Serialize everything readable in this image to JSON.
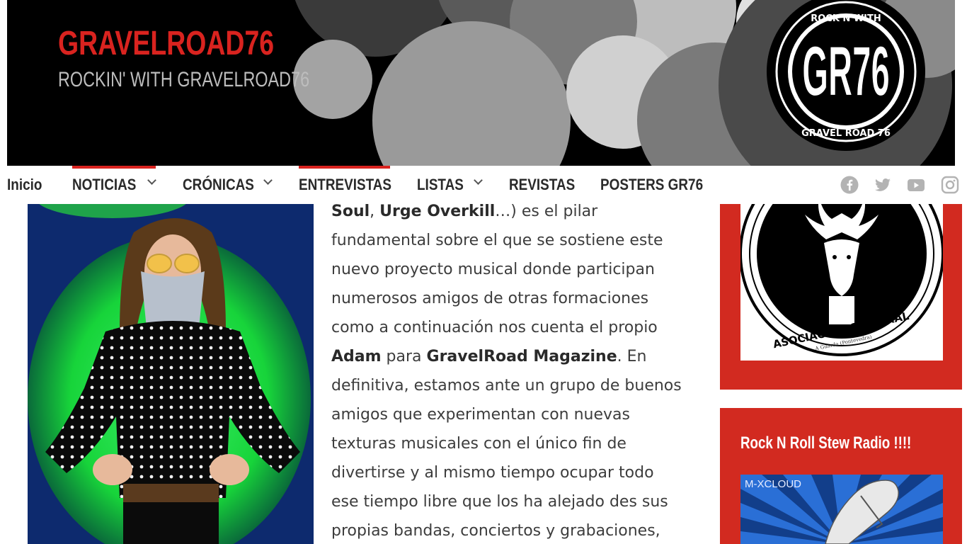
{
  "header": {
    "site_title": "GRAVELROAD76",
    "tagline": "ROCKIN' WITH GRAVELROAD76",
    "logo": {
      "top_text": "ROCK N WITH",
      "center_text": "GR76",
      "bottom_text": "GRAVEL ROAD 76"
    },
    "colors": {
      "title": "#d9231f",
      "banner_bg": "#000000"
    }
  },
  "nav": {
    "items": [
      {
        "label": "Inicio",
        "dropdown": false,
        "active": false
      },
      {
        "label": "NOTICIAS",
        "dropdown": true,
        "active": true
      },
      {
        "label": "CRÓNICAS",
        "dropdown": true,
        "active": false
      },
      {
        "label": "ENTREVISTAS",
        "dropdown": false,
        "active": true
      },
      {
        "label": "LISTAS",
        "dropdown": true,
        "active": false
      },
      {
        "label": "REVISTAS",
        "dropdown": false,
        "active": false
      },
      {
        "label": "POSTERS GR76",
        "dropdown": false,
        "active": false
      }
    ],
    "social": [
      "facebook-icon",
      "twitter-icon",
      "youtube-icon",
      "instagram-icon"
    ],
    "accent": "#d9231f"
  },
  "article": {
    "t1": "Soul",
    "t2": ", ",
    "t3": "Urge Overkill",
    "t4": "…) es el pilar fundamental sobre el que se sostiene este nuevo proyecto musical donde participan numerosos amigos de otras formaciones como a continuación nos cuenta el propio ",
    "t5": "Adam",
    "t6": " para ",
    "t7": "GravelRoad Magazine",
    "t8": ". En definitiva, estamos ante un grupo de buenos amigos que experimentan con nuevas texturas musicales con el único fin de divertirse y al mismo tiempo ocupar todo ese tiempo libre que los ha alejado des sus propias bandas, conciertos y grabaciones,"
  },
  "sidebar": {
    "widget1": {
      "image_text": "ASOCIACIÓN CULTURAL",
      "image_subtext": "A Guarda (Pontevedra)"
    },
    "widget2": {
      "title": "Rock N Roll Stew Radio !!!!",
      "player_brand": "M-XCLOUD"
    },
    "color": "#d22a20"
  }
}
